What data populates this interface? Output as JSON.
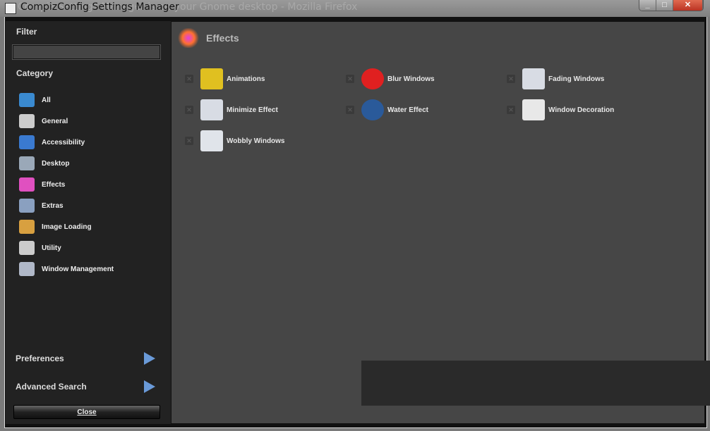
{
  "window": {
    "title": "CompizConfig Settings Manager",
    "background_title": "le Compiz Settings Manager is on your Gnome desktop - Mozilla Firefox",
    "controls": [
      "minimize",
      "maximize",
      "close"
    ]
  },
  "sidebar": {
    "filter_label": "Filter",
    "filter_value": "",
    "category_label": "Category",
    "categories": [
      {
        "label": "All",
        "icon": "globe-icon",
        "color": "#3a8ad0"
      },
      {
        "label": "General",
        "icon": "gear-icon",
        "color": "#cccccc"
      },
      {
        "label": "Accessibility",
        "icon": "wheelchair-icon",
        "color": "#3a7ad0"
      },
      {
        "label": "Desktop",
        "icon": "desktop-icon",
        "color": "#9aa8b8"
      },
      {
        "label": "Effects",
        "icon": "fireworks-icon",
        "color": "#e050c0"
      },
      {
        "label": "Extras",
        "icon": "extras-icon",
        "color": "#8aa0c0"
      },
      {
        "label": "Image Loading",
        "icon": "palette-icon",
        "color": "#d8a040"
      },
      {
        "label": "Utility",
        "icon": "gear-icon",
        "color": "#cccccc"
      },
      {
        "label": "Window Management",
        "icon": "window-icon",
        "color": "#b0b8c8"
      }
    ],
    "preferences": "Preferences",
    "advanced_search": "Advanced Search",
    "close": "Close"
  },
  "main": {
    "title": "Effects",
    "plugins": [
      {
        "label": "Animations",
        "icon": "lamp-icon",
        "color": "#e0c020",
        "enabled": false
      },
      {
        "label": "Blur Windows",
        "icon": "blur-icon",
        "color": "#e02020",
        "enabled": false
      },
      {
        "label": "Fading Windows",
        "icon": "fading-window-icon",
        "color": "#d8dce4",
        "enabled": false
      },
      {
        "label": "Minimize Effect",
        "icon": "minimize-icon",
        "color": "#d8dce4",
        "enabled": false
      },
      {
        "label": "Water Effect",
        "icon": "water-drop-icon",
        "color": "#2a5a9a",
        "enabled": false
      },
      {
        "label": "Window Decoration",
        "icon": "window-decoration-icon",
        "color": "#e8e8e8",
        "enabled": false
      },
      {
        "label": "Wobbly Windows",
        "icon": "wobbly-window-icon",
        "color": "#e0e4ea",
        "enabled": false
      }
    ]
  }
}
